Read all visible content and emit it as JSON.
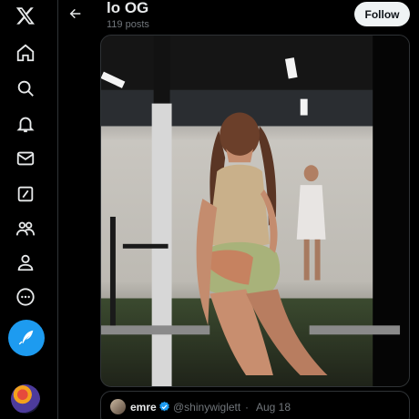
{
  "header": {
    "title": "lo OG",
    "posts_count": "119 posts",
    "follow_label": "Follow"
  },
  "nav": {
    "items": [
      {
        "name": "x-logo-icon"
      },
      {
        "name": "home-icon"
      },
      {
        "name": "search-icon"
      },
      {
        "name": "notifications-bell-icon"
      },
      {
        "name": "messages-envelope-icon"
      },
      {
        "name": "grok-icon"
      },
      {
        "name": "communities-icon"
      },
      {
        "name": "profile-icon"
      },
      {
        "name": "more-icon"
      }
    ],
    "compose": "compose-post-icon"
  },
  "media": {
    "description_icon": "photo"
  },
  "quote": {
    "name": "emre",
    "handle": "@shinywiglett",
    "separator": "·",
    "date": "Aug 18"
  },
  "colors": {
    "background": "#000000",
    "accent": "#1d9bf0",
    "text": "#e7e9ea",
    "muted": "#71767b",
    "border": "#2f3336",
    "follow_bg": "#eff3f4"
  }
}
